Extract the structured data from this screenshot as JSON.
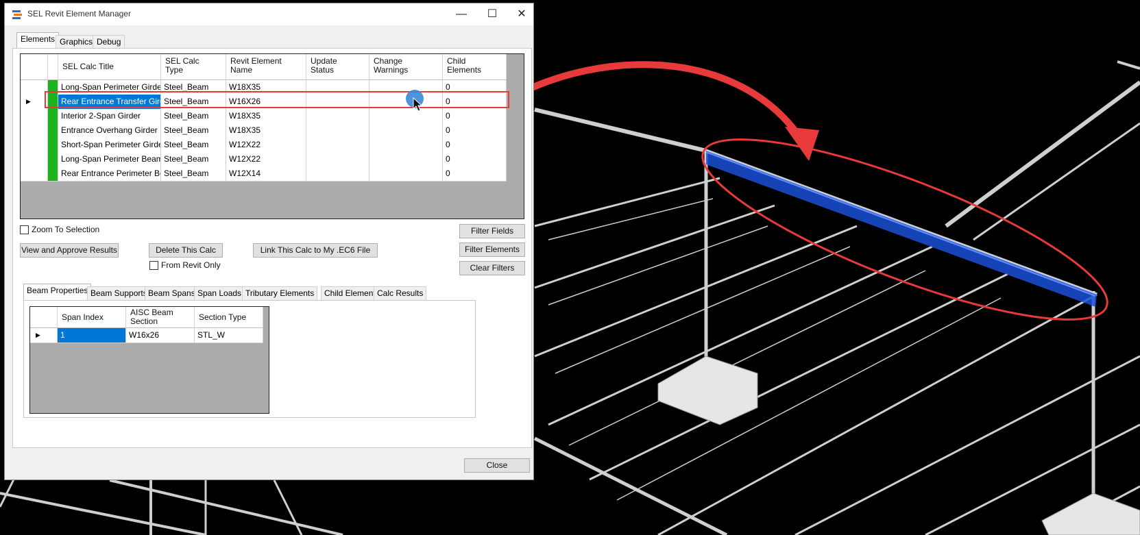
{
  "window": {
    "title": "SEL Revit Element Manager",
    "minimize_glyph": "—",
    "maximize_glyph": "☐",
    "close_glyph": "✕",
    "accent_color": "#0078d7"
  },
  "top_tabs": [
    "Elements",
    "Graphics",
    "Debug"
  ],
  "elements_grid": {
    "columns": [
      "SEL Calc Title",
      "SEL Calc\nType",
      "Revit Element\nName",
      "Update\nStatus",
      "Change\nWarnings",
      "Child\nElements"
    ],
    "rows": [
      {
        "title": "Long-Span Perimeter Girder",
        "type": "Steel_Beam",
        "name": "W18X35",
        "update": "",
        "warnings": "",
        "child": "0"
      },
      {
        "title": "Rear Entrance Transfer Girder",
        "type": "Steel_Beam",
        "name": "W16X26",
        "update": "",
        "warnings": "",
        "child": "0",
        "selected": true
      },
      {
        "title": "Interior 2-Span Girder",
        "type": "Steel_Beam",
        "name": "W18X35",
        "update": "",
        "warnings": "",
        "child": "0"
      },
      {
        "title": "Entrance Overhang Girder",
        "type": "Steel_Beam",
        "name": "W18X35",
        "update": "",
        "warnings": "",
        "child": "0"
      },
      {
        "title": "Short-Span Perimeter Girder",
        "type": "Steel_Beam",
        "name": "W12X22",
        "update": "",
        "warnings": "",
        "child": "0"
      },
      {
        "title": "Long-Span Perimeter Beam",
        "type": "Steel_Beam",
        "name": "W12X22",
        "update": "",
        "warnings": "",
        "child": "0"
      },
      {
        "title": "Rear Entrance Perimeter Beam",
        "type": "Steel_Beam",
        "name": "W12X14",
        "update": "",
        "warnings": "",
        "child": "0"
      }
    ],
    "status_color": "#1fb21f"
  },
  "controls": {
    "zoom_to_selection": "Zoom To Selection",
    "view_approve": "View and Approve Results",
    "delete_calc": "Delete This Calc",
    "from_revit_only": "From Revit Only",
    "link_calc": "Link This Calc to My .EC6 File",
    "filter_fields": "Filter Fields",
    "filter_elements": "Filter Elements",
    "clear_filters": "Clear Filters",
    "close": "Close"
  },
  "sub_tabs": [
    "Beam Properties",
    "Beam Supports",
    "Beam Spans",
    "Span Loads",
    "Tributary Elements",
    "Child Elements",
    "Calc Results"
  ],
  "span_grid": {
    "columns": [
      "Span Index",
      "AISC Beam\nSection",
      "Section Type"
    ],
    "rows": [
      {
        "index": "1",
        "section": "W16x26",
        "type": "STL_W"
      }
    ]
  },
  "annotation_color": "#e83a3a",
  "selection_marker": "▶"
}
